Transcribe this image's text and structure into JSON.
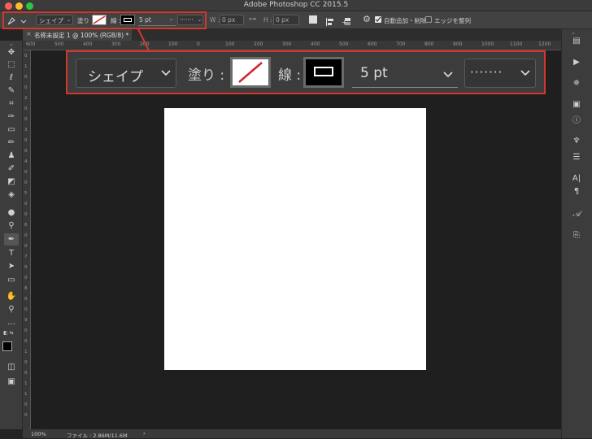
{
  "window": {
    "title": "Adobe Photoshop CC 2015.5",
    "traffic_lights": {
      "close": "#fc5f57",
      "minimize": "#fdbc2e",
      "maximize": "#29c840"
    }
  },
  "options_bar": {
    "mode": "シェイプ",
    "fill_label": "塗り :",
    "stroke_label": "線 :",
    "stroke_size": "5 pt",
    "stroke_style": "·······",
    "w_label": "W :",
    "w_value": "0 px",
    "h_label": "H :",
    "h_value": "0 px",
    "auto_add_delete_label": "自動追加・削除",
    "auto_add_delete_checked": true,
    "align_edges_label": "エッジを整列",
    "align_edges_checked": false
  },
  "callout": {
    "mode": "シェイプ",
    "fill_label": "塗り :",
    "stroke_label": "線 :",
    "stroke_size": "5 pt",
    "stroke_style": "·······"
  },
  "document": {
    "tab_title": "名称未設定 1 @ 100% (RGB/8) *",
    "zoom": "100%",
    "file_info": "ファイル : 2.86M/11.6M"
  },
  "ruler": {
    "top_ticks": [
      "600",
      "500",
      "400",
      "300",
      "200",
      "100",
      "0",
      "100",
      "200",
      "300",
      "400",
      "500",
      "600",
      "700",
      "800",
      "900",
      "1000",
      "1100",
      "1200"
    ],
    "left_ticks": [
      "0",
      "1",
      "0",
      "0",
      "2",
      "0",
      "0",
      "3",
      "0",
      "0",
      "4",
      "0",
      "0",
      "5",
      "0",
      "0",
      "6",
      "0",
      "0",
      "7",
      "0",
      "0",
      "8",
      "0",
      "0",
      "9",
      "0",
      "0",
      "1",
      "0",
      "0",
      "1",
      "1",
      "0",
      "0"
    ]
  },
  "colors": {
    "highlight": "#d5362b",
    "fill_slash": "#d0262a",
    "foreground": "#000000",
    "background": "#ffffff"
  },
  "tools": [
    "move",
    "marquee",
    "lasso",
    "quick-select",
    "crop",
    "eyedropper",
    "healing",
    "brush",
    "stamp",
    "history-brush",
    "eraser",
    "paint-bucket",
    "blur",
    "dodge",
    "pen",
    "type",
    "path-select",
    "rectangle",
    "hand",
    "zoom",
    "more"
  ],
  "right_panel_icons": [
    "collapse-panels",
    "play",
    "adjust",
    "libraries",
    "info",
    "brush-presets",
    "properties",
    "character",
    "paragraph",
    "glyphs",
    "clone-source"
  ]
}
